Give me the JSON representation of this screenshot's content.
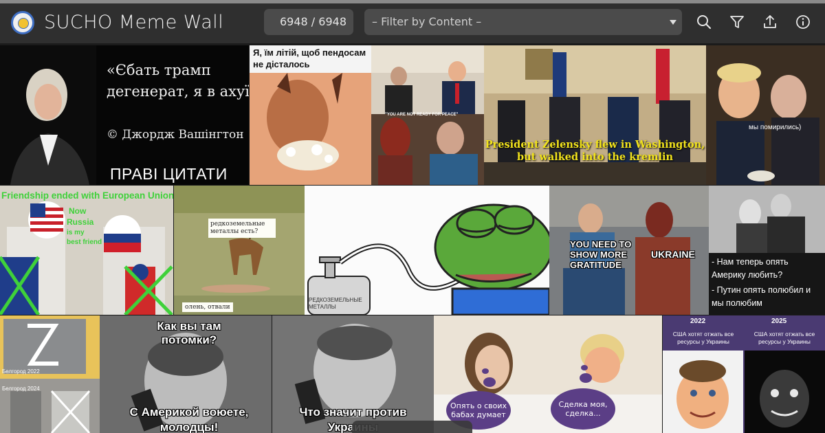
{
  "header": {
    "title": "SUCHO Meme Wall",
    "counter": "6948 / 6948",
    "filter_placeholder": "– Filter by Content –",
    "icons": [
      "search-icon",
      "filter-icon",
      "upload-icon",
      "info-icon"
    ]
  },
  "tiles": {
    "washington": {
      "quote_line1": "«Єбать трамп",
      "quote_line2": "дегенерат, я в ахуї»",
      "attribution": "© Джордж Вашінгтон",
      "banner": "ПРАВІ ЦИТАТИ"
    },
    "caracal": {
      "caption": "Я, їм літій, щоб пендосам не дісталось"
    },
    "not_ready": {
      "caption": "\"YOU ARE NOT READY FOR PEACE\""
    },
    "white_house": {
      "caption": "President Zelensky flew in Washington, but walked into the kremlin"
    },
    "dinner": {
      "caption": "мы помирились)"
    },
    "friendship": {
      "line1": "Friendship ended with European Union",
      "line2": "Now",
      "line3": "Russia",
      "line4": "is my",
      "line5": "best friend"
    },
    "deer": {
      "question": "редкоземельные металлы есть?",
      "answer": "олень, отвали"
    },
    "pepe": {
      "label": "РЕДКОЗЕМЕЛЬНЫЕ МЕТАЛЛЫ"
    },
    "gratitude": {
      "left": "YOU NEED TO SHOW MORE GRATITUDE",
      "right": "UKRAINE"
    },
    "couple": {
      "line1": "- Нам теперь опять Америку любить?",
      "line2": "- Путин опять полюбил и мы полюбим"
    },
    "belgorod": {
      "top": "Белгород 2022",
      "bottom": "Белгород 2024"
    },
    "gagarin1": {
      "top": "Как вы там потомки?",
      "bottom": "С Америкой воюете, молодцы!"
    },
    "gagarin2": {
      "bottom": "Что значит против Украины"
    },
    "bed": {
      "left": "Опять о своих бабах думает",
      "right": "Сделка моя, сделка..."
    },
    "incredible": {
      "year1": "2022",
      "text1": "США хотят отжать все ресурсы у Украины",
      "year2": "2025",
      "text2": "США хотят отжать все ресурсы у Украины"
    }
  },
  "colors": {
    "header_bg": "#2f2f2f",
    "control_bg": "#4b4b4b",
    "bubble_purple": "#5b3e86",
    "zelensky_yellow": "#f2e31c"
  }
}
